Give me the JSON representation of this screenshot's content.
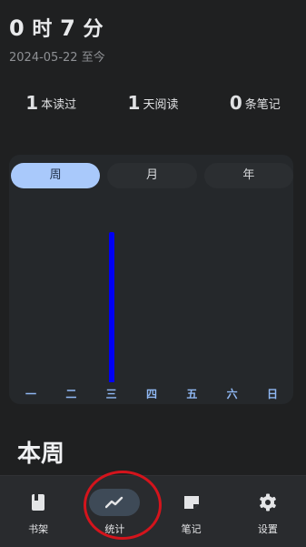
{
  "summary": {
    "time_hours": "0",
    "time_hours_unit": "时",
    "time_minutes": "7",
    "time_minutes_unit": "分",
    "since_date": "2024-05-22",
    "since_suffix": "至今"
  },
  "stats": [
    {
      "value": "1",
      "label": "本读过"
    },
    {
      "value": "1",
      "label": "天阅读"
    },
    {
      "value": "0",
      "label": "条笔记"
    }
  ],
  "period_tabs": [
    {
      "label": "周",
      "active": true
    },
    {
      "label": "月",
      "active": false
    },
    {
      "label": "年",
      "active": false
    }
  ],
  "chart_data": {
    "type": "bar",
    "categories": [
      "一",
      "二",
      "三",
      "四",
      "五",
      "六",
      "日"
    ],
    "values": [
      0,
      0,
      7,
      0,
      0,
      0,
      0
    ],
    "ylim": [
      0,
      8.5
    ],
    "grid": false,
    "bar_color": "#0000f5"
  },
  "section": {
    "title": "本周"
  },
  "nav": {
    "items": [
      {
        "label": "书架",
        "icon": "book-icon",
        "active": false
      },
      {
        "label": "统计",
        "icon": "trend-icon",
        "active": true
      },
      {
        "label": "笔记",
        "icon": "note-icon",
        "active": false
      },
      {
        "label": "设置",
        "icon": "gear-icon",
        "active": false
      }
    ]
  },
  "colors": {
    "background": "#1f2021",
    "accent": "#a9c9fb",
    "highlight_ring": "#d4141c"
  }
}
